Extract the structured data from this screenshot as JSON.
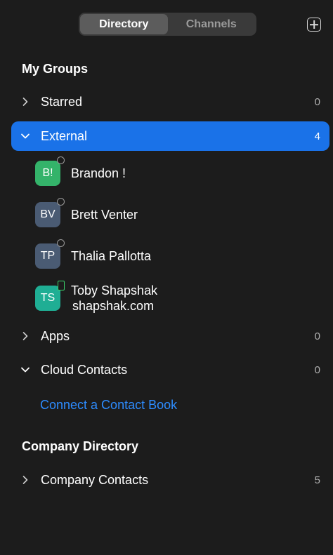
{
  "tabs": [
    {
      "label": "Directory",
      "active": true
    },
    {
      "label": "Channels",
      "active": false
    }
  ],
  "my_groups": {
    "title": "My Groups",
    "starred": {
      "label": "Starred",
      "count": "0",
      "expanded": false
    },
    "external": {
      "label": "External",
      "count": "4",
      "expanded": true,
      "contacts": [
        {
          "initials": "B!",
          "name": "Brandon !",
          "subtitle": "",
          "avatar_color": "#34b36a",
          "presence": "offline-ring"
        },
        {
          "initials": "BV",
          "name": "Brett Venter",
          "subtitle": "",
          "avatar_color": "#4a5b73",
          "presence": "offline-ring"
        },
        {
          "initials": "TP",
          "name": "Thalia Pallotta",
          "subtitle": "",
          "avatar_color": "#4a5b73",
          "presence": "offline-ring"
        },
        {
          "initials": "TS",
          "name": "Toby Shapshak",
          "subtitle": "shapshak.com",
          "avatar_color": "#1fae94",
          "presence": "mobile-device"
        }
      ]
    },
    "apps": {
      "label": "Apps",
      "count": "0",
      "expanded": false
    },
    "cloud_contacts": {
      "label": "Cloud Contacts",
      "count": "0",
      "expanded": true
    },
    "connect_link": "Connect a Contact Book"
  },
  "company_directory": {
    "title": "Company Directory",
    "company_contacts": {
      "label": "Company Contacts",
      "count": "5",
      "expanded": false
    }
  },
  "colors": {
    "background": "#1c1c1c",
    "selected_row": "#1a72e8",
    "link": "#2d8cff",
    "presence_device": "#3bd36b"
  },
  "icons": {
    "add": "plus-square-icon",
    "collapsed": "chevron-right-icon",
    "expanded": "chevron-down-icon"
  }
}
